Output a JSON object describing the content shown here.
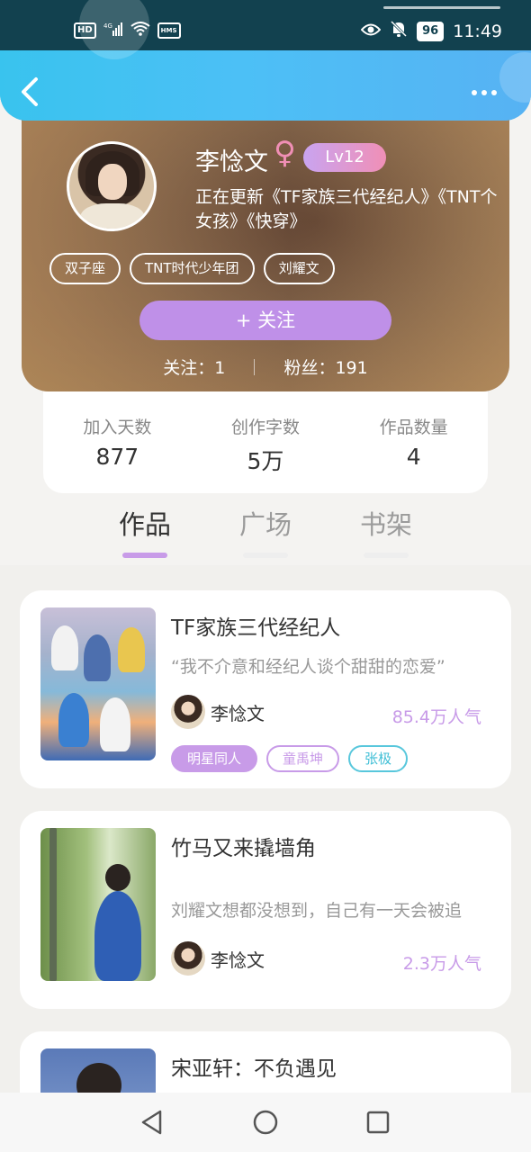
{
  "status_bar": {
    "left_badges": [
      "HD",
      "4G",
      "HMS"
    ],
    "battery": "96",
    "time": "11:49"
  },
  "profile": {
    "name": "李惗文",
    "gender_symbol": "♀",
    "level": "Lv12",
    "bio": "正在更新《TF家族三代经纪人》《TNT个女孩》《快穿》",
    "chips": [
      "双子座",
      "TNT时代少年团",
      "刘耀文"
    ],
    "follow_label": "+  关注",
    "following_label": "关注：1",
    "fans_label": "粉丝：191"
  },
  "stats": [
    {
      "label": "加入天数",
      "value": "877"
    },
    {
      "label": "创作字数",
      "value": "5万"
    },
    {
      "label": "作品数量",
      "value": "4"
    }
  ],
  "tabs": [
    {
      "label": "作品",
      "active": true
    },
    {
      "label": "广场",
      "active": false
    },
    {
      "label": "书架",
      "active": false
    }
  ],
  "books": [
    {
      "title": "TF家族三代经纪人",
      "desc": "“我不介意和经纪人谈个甜甜的恋爱”",
      "author": "李惗文",
      "popularity": "85.4万人气",
      "tags": [
        "明星同人",
        "童禹坤",
        "张极"
      ]
    },
    {
      "title": "竹马又来撬墙角",
      "desc": "刘耀文想都没想到，自己有一天会被追",
      "author": "李惗文",
      "popularity": "2.3万人气",
      "tags": []
    },
    {
      "title": "宋亚轩：不负遇见",
      "desc": "",
      "author": "",
      "popularity": "",
      "tags": []
    }
  ],
  "colors": {
    "accent_purple": "#c89be8",
    "header_blue": "#43c6ef",
    "tag_cyan": "#58c7dc"
  },
  "icons": {
    "back": "chevron-left-icon",
    "more": "more-dots-icon",
    "nav_back": "triangle-back-icon",
    "nav_home": "circle-home-icon",
    "nav_recent": "square-recent-icon"
  }
}
